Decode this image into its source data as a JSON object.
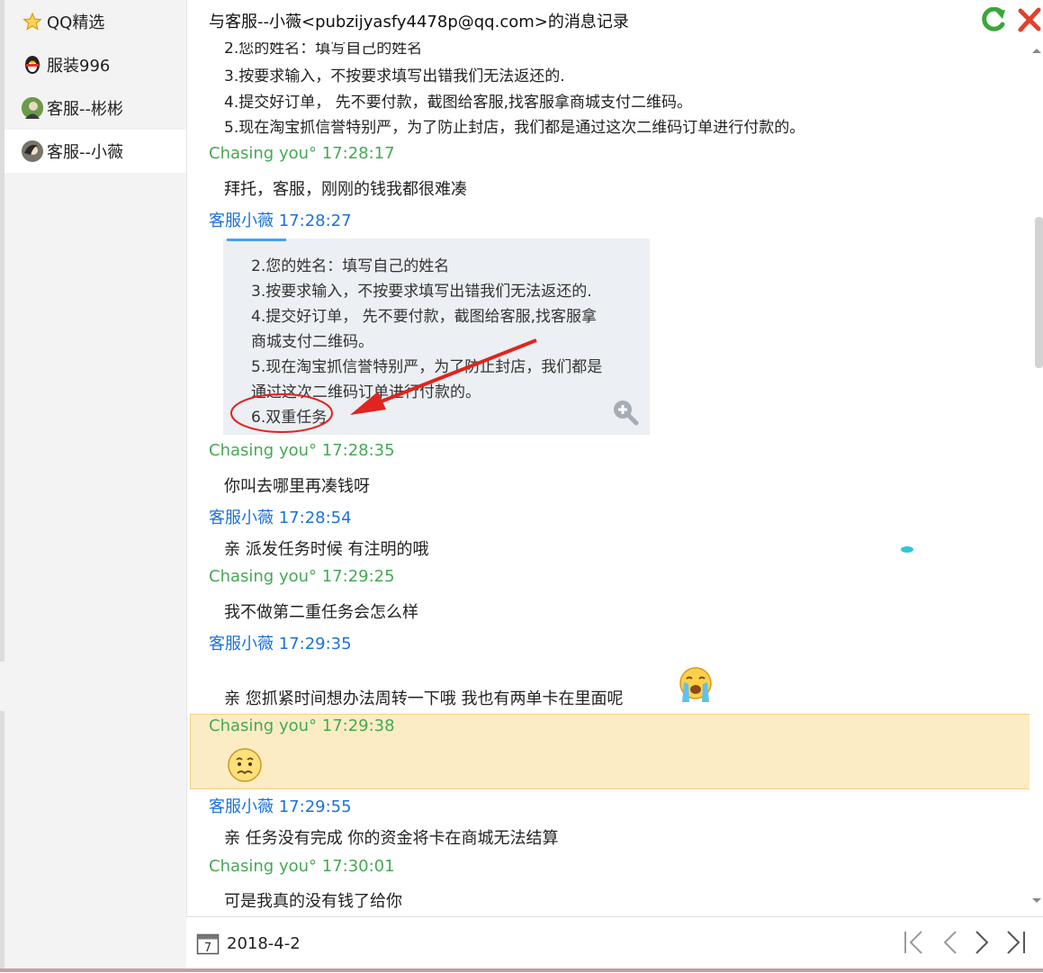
{
  "sidebar": {
    "items": [
      {
        "label": "QQ精选",
        "icon": "star-icon",
        "active": false
      },
      {
        "label": "服装996",
        "icon": "qq-penguin-icon",
        "active": false
      },
      {
        "label": "客服--彬彬",
        "icon": "avatar-icon",
        "active": false
      },
      {
        "label": "客服--小薇",
        "icon": "avatar-icon",
        "active": true
      }
    ]
  },
  "header": {
    "title": "与客服--小薇<pubzijyasfy4478p@qq.com>的消息记录",
    "back_icon": "green-return-arrow-icon",
    "close_icon": "red-x-icon"
  },
  "chat": {
    "top_partial": "2.您的姓名：填写自己的姓名",
    "top_lines": [
      "3.按要求输入，不按要求填写出错我们无法返还的.",
      "4.提交好订单， 先不要付款，截图给客服,找客服拿商城支付二维码。",
      "5.现在淘宝抓信誉特别严，为了防止封店，我们都是通过这次二维码订单进行付款的。"
    ],
    "messages": [
      {
        "sender": "Chasing you° 17:28:17",
        "text": "拜托，客服，刚刚的钱我都很难凑"
      },
      {
        "sender": "客服小薇 17:28:27",
        "text": ""
      },
      {
        "sender": "Chasing you° 17:28:35",
        "text": "你叫去哪里再凑钱呀"
      },
      {
        "sender": "客服小薇 17:28:54",
        "text": "亲  派发任务时候 有注明的哦"
      },
      {
        "sender": "Chasing you° 17:29:25",
        "text": "我不做第二重任务会怎么样"
      },
      {
        "sender": "客服小薇 17:29:35",
        "text": "亲 您抓紧时间想办法周转一下哦 我也有两单卡在里面呢"
      },
      {
        "sender": "Chasing you° 17:29:38",
        "text": ""
      },
      {
        "sender": "客服小薇 17:29:55",
        "text": "亲 任务没有完成 你的资金将卡在商城无法结算"
      },
      {
        "sender": "Chasing you° 17:30:01",
        "text": "可是我真的没有钱了给你"
      }
    ],
    "image_lines": [
      "2.您的姓名：填写自己的姓名",
      "3.按要求输入，不按要求填写出错我们无法返还的.",
      "4.提交好订单， 先不要付款，截图给客服,找客服拿",
      "商城支付二维码。",
      "5.现在淘宝抓信誉特别严，为了防止封店，我们都是",
      "通过这次二维码订单进行付款的。",
      "6.双重任务"
    ]
  },
  "footer": {
    "date": "2018-4-2",
    "calendar_day": "7",
    "nav_icons": [
      "first-page-icon",
      "prev-page-icon",
      "next-page-icon",
      "last-page-icon"
    ]
  },
  "colors": {
    "me": "#45a856",
    "support": "#1c72d8",
    "highlight_bg": "#fcecc4",
    "arrow": "#e0241f"
  }
}
